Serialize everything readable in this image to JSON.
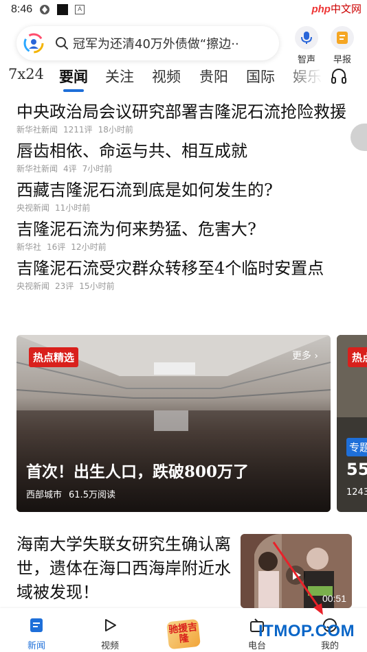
{
  "status_bar": {
    "time": "8:46",
    "a_icon": "A"
  },
  "watermark_top": {
    "brand": "php",
    "site": "中文网"
  },
  "search": {
    "placeholder": "冠军为还清40万外债做“擦边··"
  },
  "top_buttons": [
    {
      "label": "智声",
      "icon": "microphone-icon"
    },
    {
      "label": "早报",
      "icon": "newspaper-icon"
    }
  ],
  "tabs": [
    "7x24",
    "要闻",
    "关注",
    "视频",
    "贵阳",
    "国际",
    "娱乐"
  ],
  "active_tab": "要闻",
  "news": [
    {
      "title": "中央政治局会议研究部署吉隆泥石流抢险救援",
      "source": "新华社新闻",
      "comments": "1211评",
      "time": "18小时前"
    },
    {
      "title": "唇齿相依、命运与共、相互成就",
      "source": "新华社新闻",
      "comments": "4评",
      "time": "7小时前"
    },
    {
      "title": "西藏吉隆泥石流到底是如何发生的?",
      "source": "央视新闻",
      "comments": "",
      "time": "11小时前"
    },
    {
      "title": "吉隆泥石流为何来势猛、危害大?",
      "source": "新华社",
      "comments": "16评",
      "time": "12小时前"
    },
    {
      "title": "吉隆泥石流受灾群众转移至4个临时安置点",
      "source": "央视新闻",
      "comments": "23评",
      "time": "15小时前"
    }
  ],
  "hot_card": {
    "badge": "热点精选",
    "more": "更多",
    "title": "首次！出生人口，跌破800万了",
    "source": "西部城市",
    "reads": "61.5万阅读"
  },
  "side_card": {
    "badge": "热点",
    "tag": "专题",
    "number": "55",
    "sub": "1243"
  },
  "feature": {
    "title": "海南大学失联女研究生确认离世，遗体在海口西海岸附近水域被发现！",
    "duration": "00:51"
  },
  "bottom_nav": {
    "items": [
      {
        "label": "新闻",
        "icon": "news-icon"
      },
      {
        "label": "视频",
        "icon": "play-icon"
      },
      {
        "label": "电台",
        "icon": "radio-icon"
      },
      {
        "label": "我的",
        "icon": "profile-icon"
      }
    ],
    "center_logo": "驰援吉隆"
  },
  "watermark_bottom": "ITMOP.COM",
  "colors": {
    "accent": "#1e6fd9",
    "badge_red": "#d9201c"
  }
}
